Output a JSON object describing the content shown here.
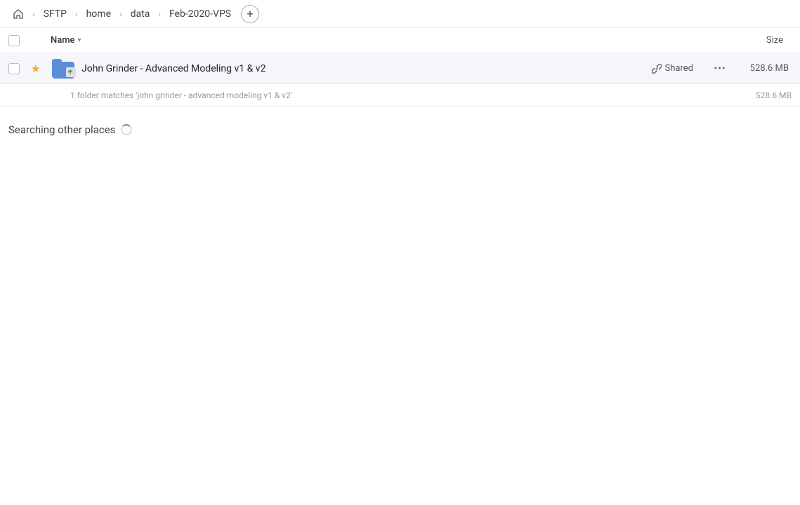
{
  "breadcrumb": {
    "home_icon": "⌂",
    "items": [
      "SFTP",
      "home",
      "data",
      "Feb-2020-VPS"
    ],
    "add_label": "+"
  },
  "columns": {
    "name_label": "Name",
    "name_arrow": "▾",
    "size_label": "Size"
  },
  "file_row": {
    "star": "★",
    "name": "John Grinder - Advanced Modeling v1 & v2",
    "shared_label": "Shared",
    "more_icon": "···",
    "size": "528.6 MB"
  },
  "match_info": {
    "text": "1 folder matches 'john grinder - advanced modeling v1 & v2'",
    "size": "528.6 MB"
  },
  "searching": {
    "label": "Searching other places"
  }
}
